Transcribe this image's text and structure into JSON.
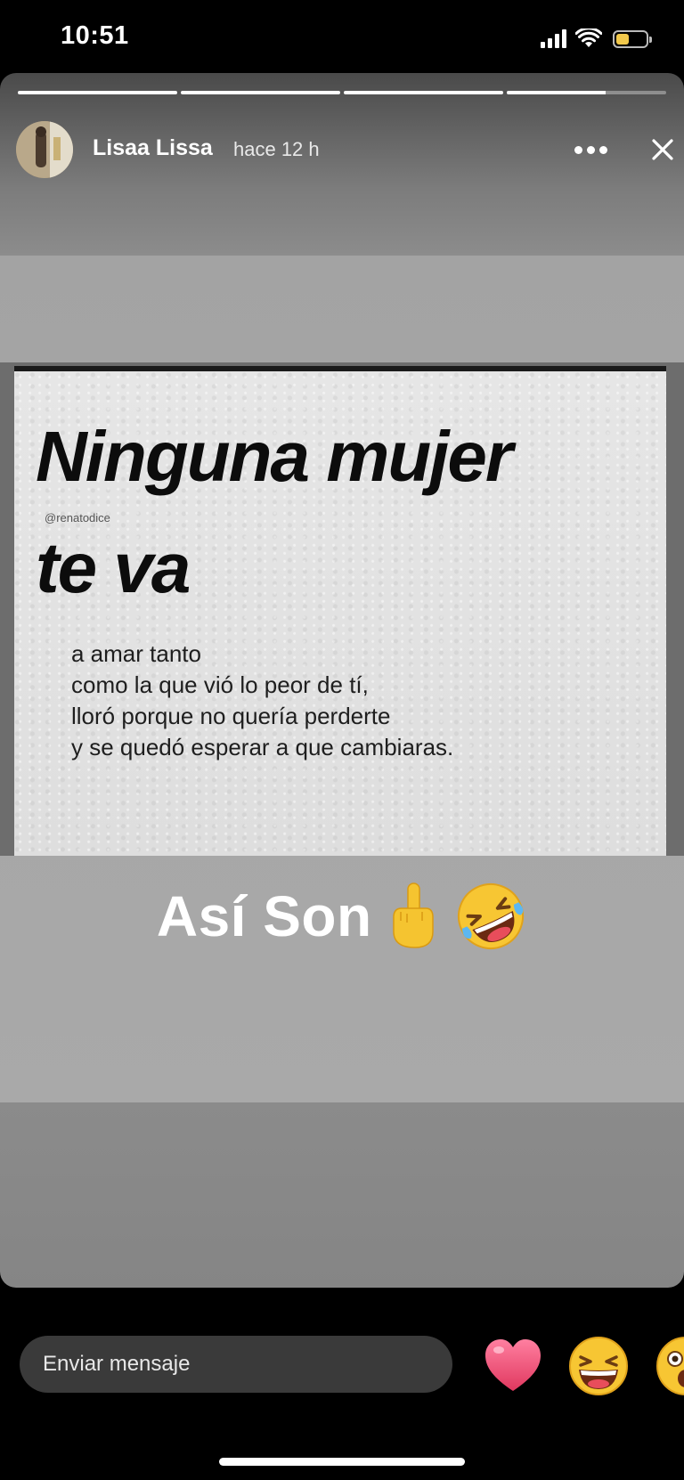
{
  "status_bar": {
    "time": "10:51",
    "battery_level": 0.45,
    "battery_color": "#f2c94c"
  },
  "story": {
    "progress": [
      1.0,
      1.0,
      1.0,
      0.62
    ],
    "username": "Lisaa Lissa",
    "timestamp": "hace 12 h",
    "more_icon": "more-horizontal-icon",
    "close_icon": "close-icon"
  },
  "quote_image": {
    "headline_line1": "Ninguna mujer",
    "handle": "@renatodice",
    "headline_line2": "te va",
    "body_lines": [
      "a amar tanto",
      "como la que vió lo peor de tí,",
      "lloró porque no quería perderte",
      "y se quedó esperar a que cambiaras."
    ]
  },
  "caption": {
    "text": "Así Son",
    "emojis": [
      "middle-finger-icon",
      "rolling-laughing-icon"
    ]
  },
  "bottom_bar": {
    "message_placeholder": "Enviar mensaje",
    "reactions": [
      "heart-icon",
      "laughing-face-icon",
      "surprised-face-icon"
    ]
  }
}
